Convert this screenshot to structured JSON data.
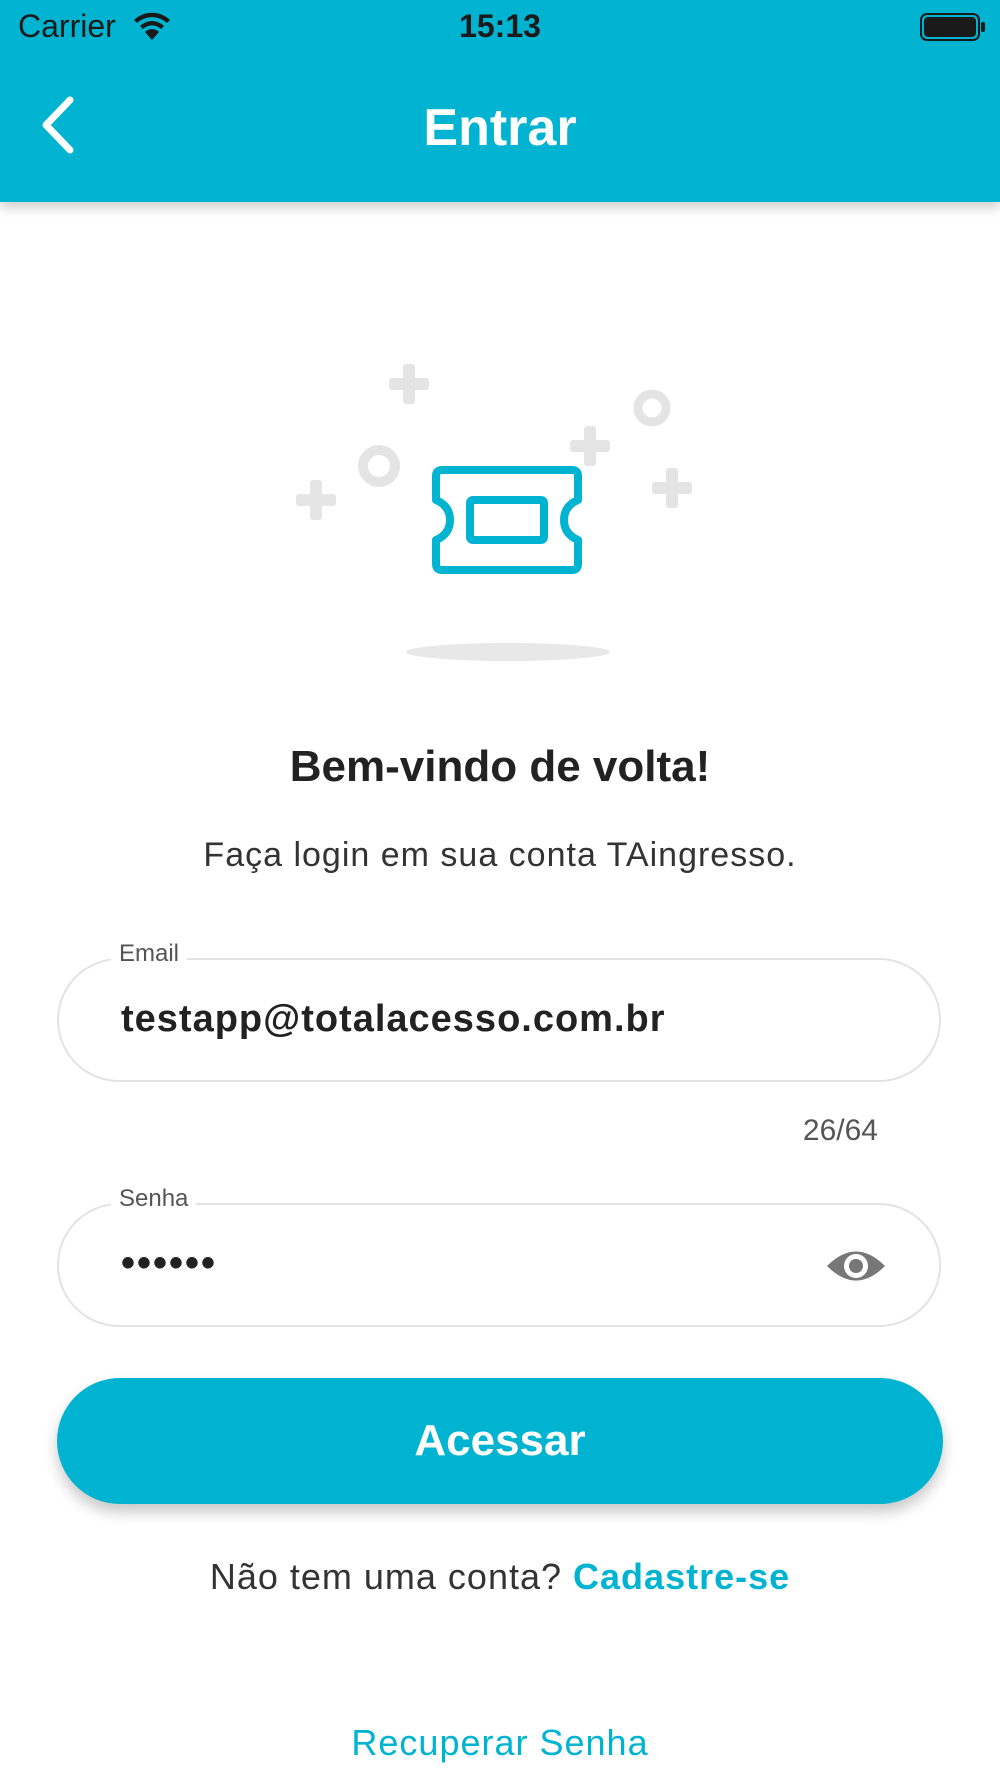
{
  "status_bar": {
    "carrier": "Carrier",
    "time": "15:13",
    "wifi_icon": "wifi-icon",
    "battery_icon": "battery-icon"
  },
  "header": {
    "title": "Entrar",
    "back_icon": "chevron-left-icon"
  },
  "illustration": {
    "icon": "ticket-icon"
  },
  "welcome": {
    "title": "Bem-vindo de volta!",
    "subtitle": "Faça login em sua conta TAingresso."
  },
  "email_field": {
    "label": "Email",
    "value": "testapp@totalacesso.com.br",
    "counter": "26/64"
  },
  "password_field": {
    "label": "Senha",
    "masked_value": "••••••",
    "toggle_icon": "eye-icon"
  },
  "primary_button": {
    "label": "Acessar"
  },
  "signup": {
    "prompt": "Não tem uma conta?",
    "link": "Cadastre-se"
  },
  "recover": {
    "link": "Recuperar Senha"
  },
  "colors": {
    "accent": "#00B4D1",
    "text_dark": "#222222",
    "border": "#e3e3e3"
  }
}
